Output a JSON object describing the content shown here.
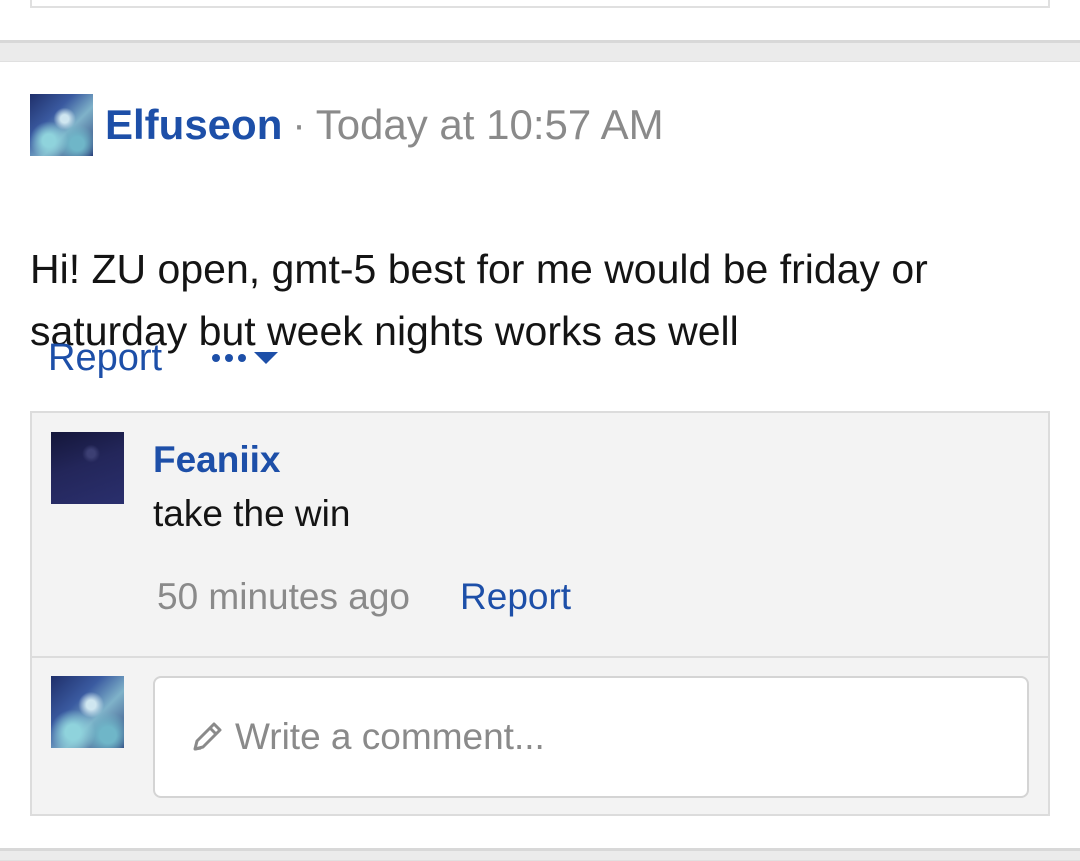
{
  "post": {
    "author": "Elfuseon",
    "separator": "·",
    "timestamp": "Today at 10:57 AM",
    "body_lines": [
      "Hi! ZU open, gmt-5 best for me would be friday or",
      "saturday but week nights works as well"
    ],
    "actions": {
      "report_label": "Report",
      "more_icon": "ellipsis-caret-icon"
    }
  },
  "comment": {
    "author": "Feaniix",
    "text": "take the win",
    "time": "50 minutes ago",
    "report_label": "Report"
  },
  "reply": {
    "placeholder": "Write a comment...",
    "icon": "pencil-icon"
  },
  "colors": {
    "link": "#1d4fa8",
    "muted": "#8a8a8a",
    "text": "#141414",
    "comment_bg": "#f3f3f3"
  }
}
